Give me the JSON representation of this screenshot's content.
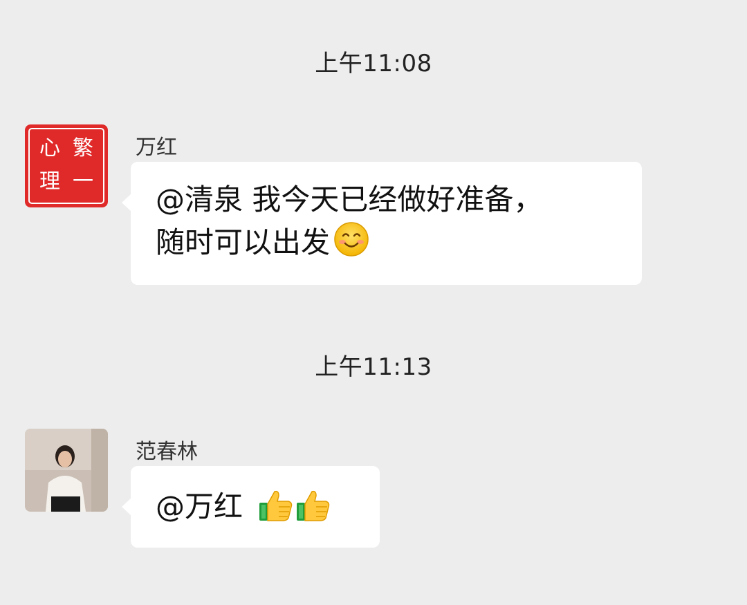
{
  "messages": [
    {
      "timestamp": "上午11:08",
      "sender": "万红",
      "avatar": {
        "type": "seal-logo",
        "bg": "#e02a2a",
        "glyphs": [
          "繁",
          "一",
          "心",
          "理"
        ]
      },
      "text_lines": [
        "@清泉  我今天已经做好准备，",
        "随时可以出发"
      ],
      "emoji": "smiling-face-emoji"
    },
    {
      "timestamp": "上午11:13",
      "sender": "范春林",
      "avatar": {
        "type": "photo"
      },
      "text": "@万红",
      "emoji": "thumbs-up-emoji"
    }
  ],
  "colors": {
    "background": "#ededed",
    "bubble": "#ffffff",
    "seal_red": "#e02a2a"
  }
}
